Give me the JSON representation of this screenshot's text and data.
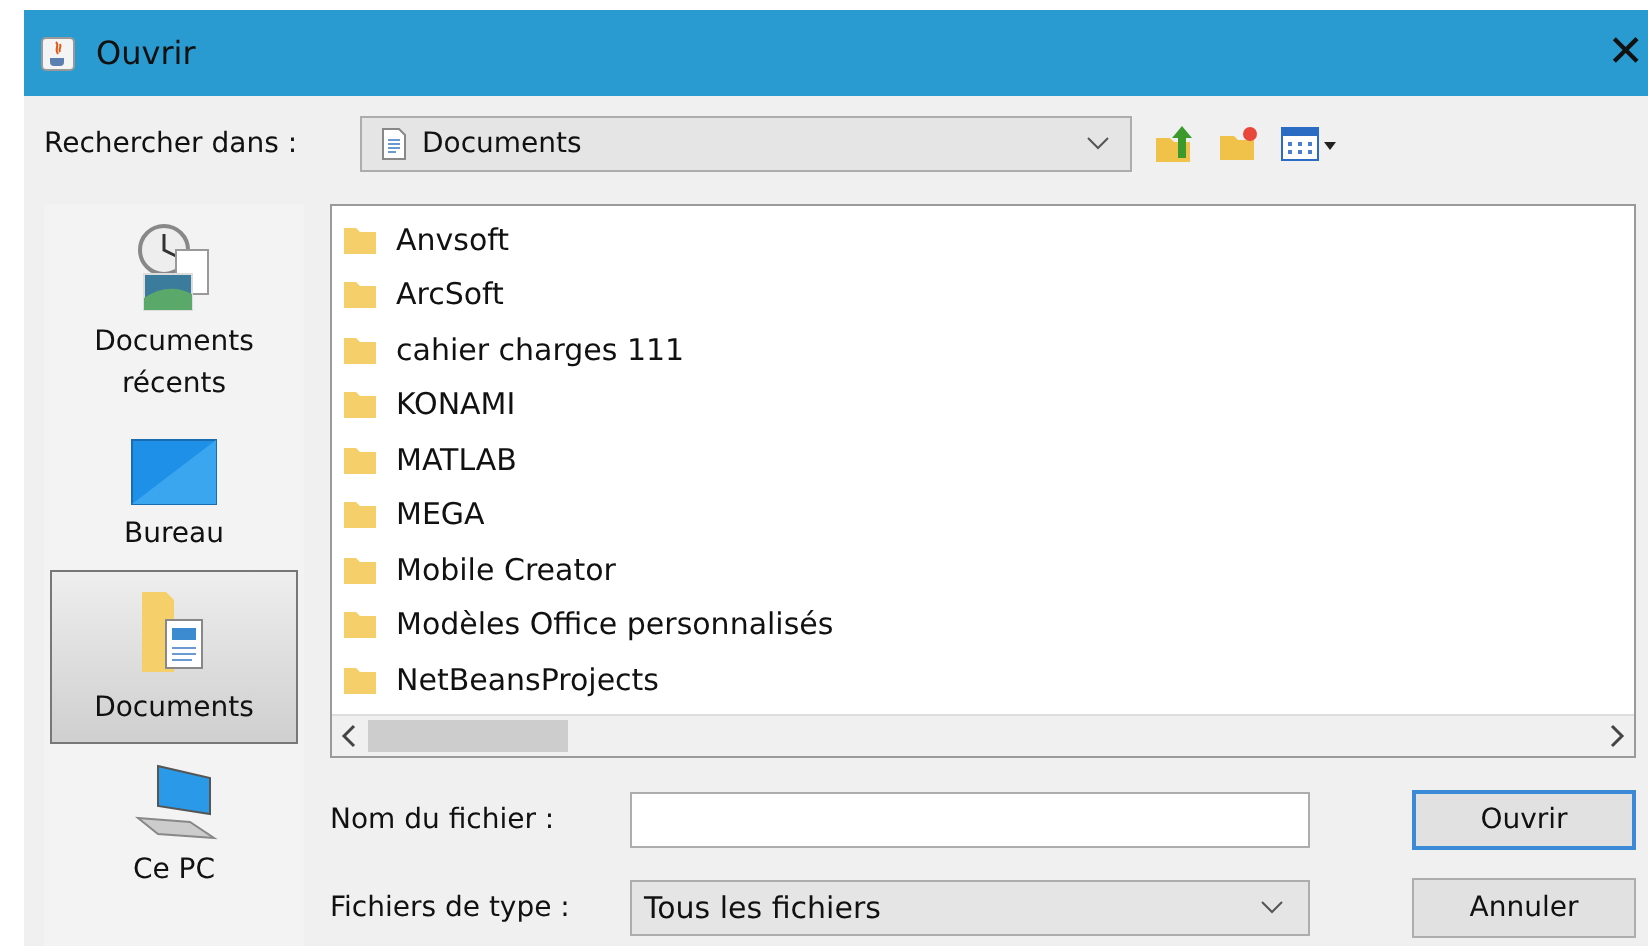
{
  "window": {
    "title": "Ouvrir",
    "close": "✕"
  },
  "look_in": {
    "label": "Rechercher dans :",
    "value": "Documents"
  },
  "places": [
    {
      "label": "Documents\nrécents",
      "kind": "recent",
      "selected": false
    },
    {
      "label": "Bureau",
      "kind": "desktop",
      "selected": false
    },
    {
      "label": "Documents",
      "kind": "documents",
      "selected": true
    },
    {
      "label": "Ce PC",
      "kind": "computer",
      "selected": false
    }
  ],
  "files": [
    {
      "name": "Anvsoft"
    },
    {
      "name": "ArcSoft"
    },
    {
      "name": "cahier charges 111"
    },
    {
      "name": "KONAMI"
    },
    {
      "name": "MATLAB"
    },
    {
      "name": "MEGA"
    },
    {
      "name": "Mobile Creator"
    },
    {
      "name": "Modèles Office personnalisés"
    },
    {
      "name": "NetBeansProjects"
    }
  ],
  "file_name": {
    "label": "Nom du fichier :"
  },
  "file_type": {
    "label": "Fichiers de type :",
    "value": "Tous les fichiers"
  },
  "buttons": [
    "Ouvrir",
    "Annuler"
  ]
}
